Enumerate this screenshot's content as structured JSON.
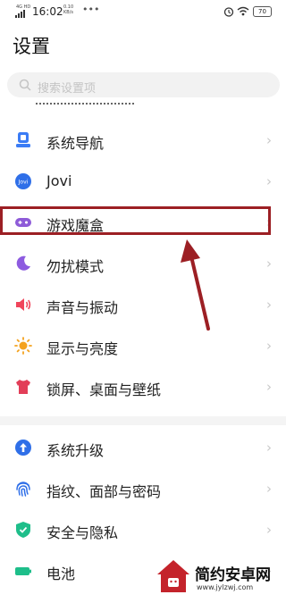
{
  "status_bar": {
    "network": "4G HD",
    "time": "16:02",
    "speed_value": "0.10",
    "speed_unit": "KB/s",
    "battery": "70",
    "icons": [
      "signal-icon",
      "wifi-icon",
      "alarm-icon",
      "battery-icon",
      "more-dots-icon"
    ]
  },
  "page": {
    "title": "设置"
  },
  "search": {
    "placeholder": "搜索设置项"
  },
  "items": [
    {
      "label": "系统导航",
      "icon": "system-navigation-icon",
      "color": "#3b7cf5"
    },
    {
      "label": "Jovi",
      "icon": "jovi-icon",
      "color": "#2f6fe8"
    },
    {
      "label": "游戏魔盒",
      "icon": "game-box-icon",
      "color": "#8e5bd8"
    },
    {
      "label": "勿扰模式",
      "icon": "do-not-disturb-icon",
      "color": "#8d5be0"
    },
    {
      "label": "声音与振动",
      "icon": "sound-icon",
      "color": "#f0455b"
    },
    {
      "label": "显示与亮度",
      "icon": "brightness-icon",
      "color": "#f4a21e"
    },
    {
      "label": "锁屏、桌面与壁纸",
      "icon": "wallpaper-icon",
      "color": "#e23e58"
    },
    {
      "label": "系统升级",
      "icon": "system-update-icon",
      "color": "#2f6fe8"
    },
    {
      "label": "指纹、面部与密码",
      "icon": "fingerprint-icon",
      "color": "#2f6fe8"
    },
    {
      "label": "安全与隐私",
      "icon": "security-icon",
      "color": "#1ebe8a"
    },
    {
      "label": "电池",
      "icon": "battery-setting-icon",
      "color": "#1ebe8a"
    }
  ],
  "annotation": {
    "color": "#9c1f24"
  },
  "watermark": {
    "brand": "简约安卓网",
    "url": "www.jylzwj.com"
  }
}
